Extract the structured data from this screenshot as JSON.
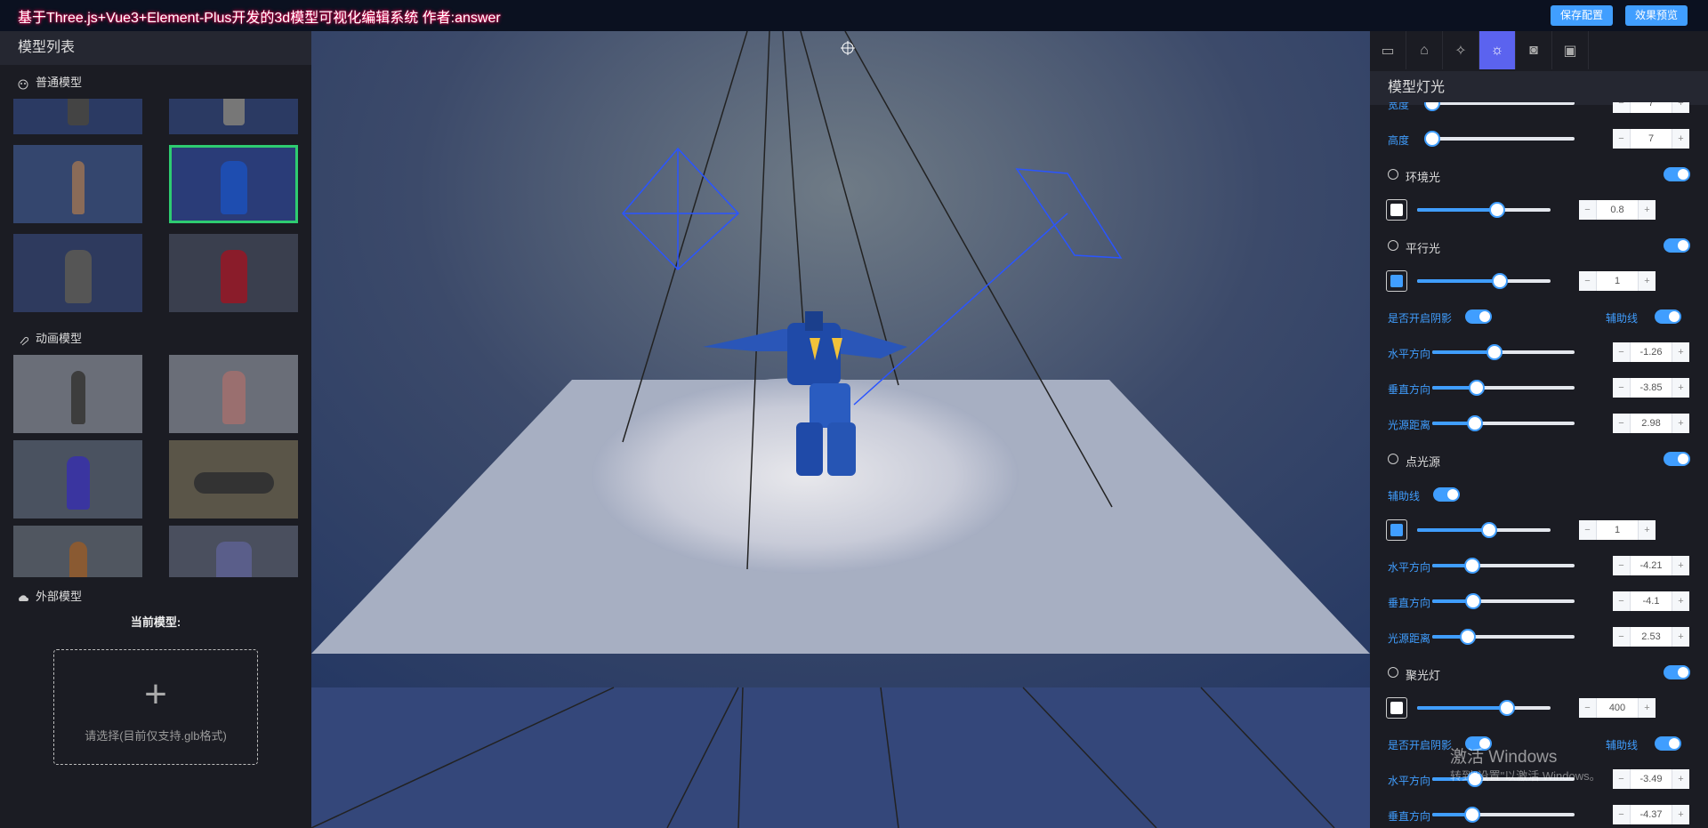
{
  "app": {
    "title": "基于Three.js+Vue3+Element-Plus开发的3d模型可视化编辑系统 作者:answer",
    "save_btn": "保存配置",
    "preview_btn": "效果预览"
  },
  "left": {
    "header": "模型列表",
    "normal_section": "普通模型",
    "anim_section": "动画模型",
    "external_section": "外部模型",
    "current_label": "当前模型:",
    "upload_tip": "请选择(目前仅支持.glb格式)",
    "normal_models": [
      "",
      "",
      "",
      "",
      "",
      ""
    ],
    "anim_models": [
      "",
      "",
      "",
      "",
      "",
      ""
    ]
  },
  "right": {
    "tabs": [
      "background-icon",
      "stage-icon",
      "sparkle-icon",
      "light-icon",
      "camera-icon",
      "box-icon"
    ],
    "active_tab": 3,
    "header": "模型灯光",
    "rows": [
      {
        "kind": "slider",
        "label": "宽度",
        "value": "7",
        "fraction": 0.0
      },
      {
        "kind": "slider",
        "label": "高度",
        "value": "7",
        "fraction": 0.0
      },
      {
        "kind": "section",
        "label": "环境光",
        "on": true
      },
      {
        "kind": "color",
        "color": "#ffffff",
        "value": "0.8",
        "fraction": 0.6
      },
      {
        "kind": "section",
        "label": "平行光",
        "on": true
      },
      {
        "kind": "color",
        "color": "#409eff",
        "value": "1",
        "fraction": 0.62
      },
      {
        "kind": "toggles",
        "left": "是否开启阴影",
        "right": "辅助线"
      },
      {
        "kind": "slider",
        "label": "水平方向",
        "value": "-1.26",
        "fraction": 0.44
      },
      {
        "kind": "slider",
        "label": "垂直方向",
        "value": "-3.85",
        "fraction": 0.31
      },
      {
        "kind": "slider",
        "label": "光源距离",
        "value": "2.98",
        "fraction": 0.3
      },
      {
        "kind": "section",
        "label": "点光源",
        "on": true
      },
      {
        "kind": "toggle1",
        "left": "辅助线"
      },
      {
        "kind": "color",
        "color": "#409eff",
        "value": "1",
        "fraction": 0.54
      },
      {
        "kind": "slider",
        "label": "水平方向",
        "value": "-4.21",
        "fraction": 0.28
      },
      {
        "kind": "slider",
        "label": "垂直方向",
        "value": "-4.1",
        "fraction": 0.29
      },
      {
        "kind": "slider",
        "label": "光源距离",
        "value": "2.53",
        "fraction": 0.25
      },
      {
        "kind": "section",
        "label": "聚光灯",
        "on": true
      },
      {
        "kind": "color",
        "color": "#ffffff",
        "value": "400",
        "fraction": 0.67
      },
      {
        "kind": "toggles",
        "left": "是否开启阴影",
        "right": "辅助线"
      },
      {
        "kind": "slider",
        "label": "水平方向",
        "value": "-3.49",
        "fraction": 0.3
      },
      {
        "kind": "slider",
        "label": "垂直方向",
        "value": "-4.37",
        "fraction": 0.28
      }
    ]
  },
  "watermark": {
    "line1": "激活 Windows",
    "line2": "转到\"设置\"以激活 Windows。"
  }
}
